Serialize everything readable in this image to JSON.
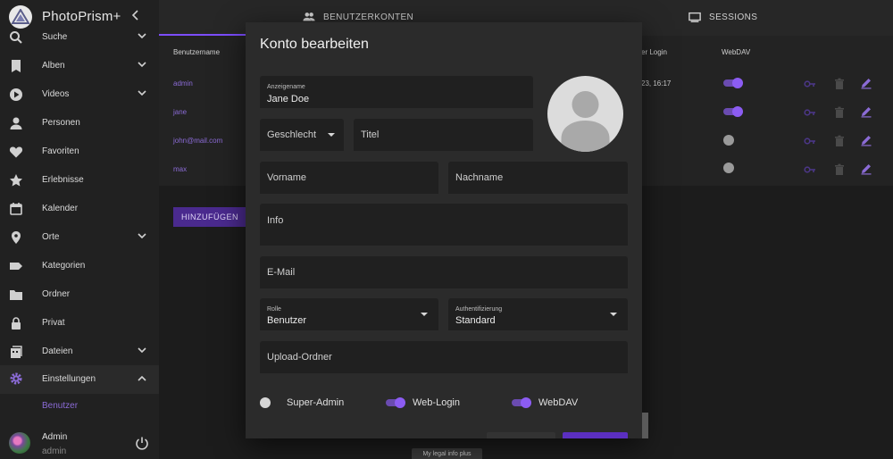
{
  "app": {
    "brand": "PhotoPrism+"
  },
  "sidebar": {
    "items": [
      {
        "label": "Suche",
        "icon": "search-icon",
        "has_chevron": true
      },
      {
        "label": "Alben",
        "icon": "bookmark-icon",
        "has_chevron": true
      },
      {
        "label": "Videos",
        "icon": "play-circle-icon",
        "has_chevron": true
      },
      {
        "label": "Personen",
        "icon": "person-icon",
        "has_chevron": false
      },
      {
        "label": "Favoriten",
        "icon": "heart-icon",
        "has_chevron": false
      },
      {
        "label": "Erlebnisse",
        "icon": "star-icon",
        "has_chevron": false
      },
      {
        "label": "Kalender",
        "icon": "calendar-icon",
        "has_chevron": false
      },
      {
        "label": "Orte",
        "icon": "map-pin-icon",
        "has_chevron": true
      },
      {
        "label": "Kategorien",
        "icon": "label-icon",
        "has_chevron": false
      },
      {
        "label": "Ordner",
        "icon": "folder-icon",
        "has_chevron": false
      },
      {
        "label": "Privat",
        "icon": "lock-icon",
        "has_chevron": false
      },
      {
        "label": "Dateien",
        "icon": "files-icon",
        "has_chevron": true
      },
      {
        "label": "Einstellungen",
        "icon": "gear-icon",
        "has_chevron": true
      }
    ],
    "sub_item": {
      "label": "Benutzer"
    },
    "user": {
      "name": "Admin",
      "login": "admin"
    }
  },
  "tabs": [
    {
      "label": "BENUTZERKONTEN",
      "icon": "people-icon"
    },
    {
      "label": "SESSIONS",
      "icon": "monitor-icon"
    }
  ],
  "table": {
    "headers": {
      "username": "Benutzername",
      "last_login": "er Login",
      "webdav": "WebDAV"
    },
    "rows": [
      {
        "username": "admin",
        "last_login": "23, 16:17",
        "webdav": true
      },
      {
        "username": "jane",
        "last_login": "",
        "webdav": true
      },
      {
        "username": "john@mail.com",
        "last_login": "",
        "webdav": false
      },
      {
        "username": "max",
        "last_login": "",
        "webdav": false
      }
    ],
    "add_label": "HINZUFÜGEN"
  },
  "legal": "My legal info plus",
  "dialog": {
    "title": "Konto bearbeiten",
    "display_name": {
      "label": "Anzeigename",
      "value": "Jane Doe"
    },
    "gender": {
      "placeholder": "Geschlecht"
    },
    "title_field": {
      "placeholder": "Titel"
    },
    "first_name": {
      "placeholder": "Vorname"
    },
    "last_name": {
      "placeholder": "Nachname"
    },
    "info": {
      "placeholder": "Info"
    },
    "email": {
      "placeholder": "E-Mail"
    },
    "role": {
      "label": "Rolle",
      "value": "Benutzer"
    },
    "auth": {
      "label": "Authentifizierung",
      "value": "Standard"
    },
    "upload_folder": {
      "placeholder": "Upload-Ordner"
    },
    "switches": [
      {
        "label": "Super-Admin",
        "on": false
      },
      {
        "label": "Web-Login",
        "on": true
      },
      {
        "label": "WebDAV",
        "on": true
      }
    ]
  },
  "colors": {
    "accent": "#7c4dff",
    "link": "#8b6bd6",
    "toggle_on": "#8c5cf2"
  }
}
